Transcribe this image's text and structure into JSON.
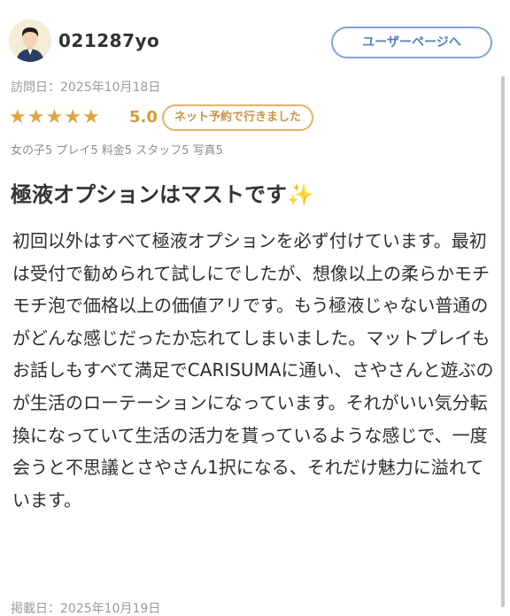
{
  "user": {
    "name": "021287yo",
    "user_page_label": "ユーザーページへ"
  },
  "visit": {
    "label": "訪問日：2025年10月18日"
  },
  "rating": {
    "stars": 5,
    "score": "5.0",
    "badge": "ネット予約で行きました",
    "star_color": "#e0a63e"
  },
  "sub_ratings": "女の子5 プレイ5 料金5 スタッフ5 写真5",
  "review": {
    "title": "極液オプションはマストです",
    "title_emoji": "✨",
    "body": "初回以外はすべて極液オプションを必ず付けています。最初は受付で勧められて試しにでしたが、想像以上の柔らかモチモチ泡で価格以上の価値アリです。もう極液じゃない普通のがどんな感じだったか忘れてしまいました。マットプレイもお話しもすべて満足でCARISUMAに通い、さやさんと遊ぶのが生活のローテーションになっています。それがいい気分転換になっていて生活の活力を貰っているような感じで、一度会うと不思議とさやさん1択になる、それだけ魅力に溢れています。"
  },
  "posted": {
    "label": "掲載日：2025年10月19日"
  },
  "icons": {
    "avatar": "user-avatar-icon",
    "star": "star-icon",
    "sparkle": "sparkles-emoji"
  }
}
